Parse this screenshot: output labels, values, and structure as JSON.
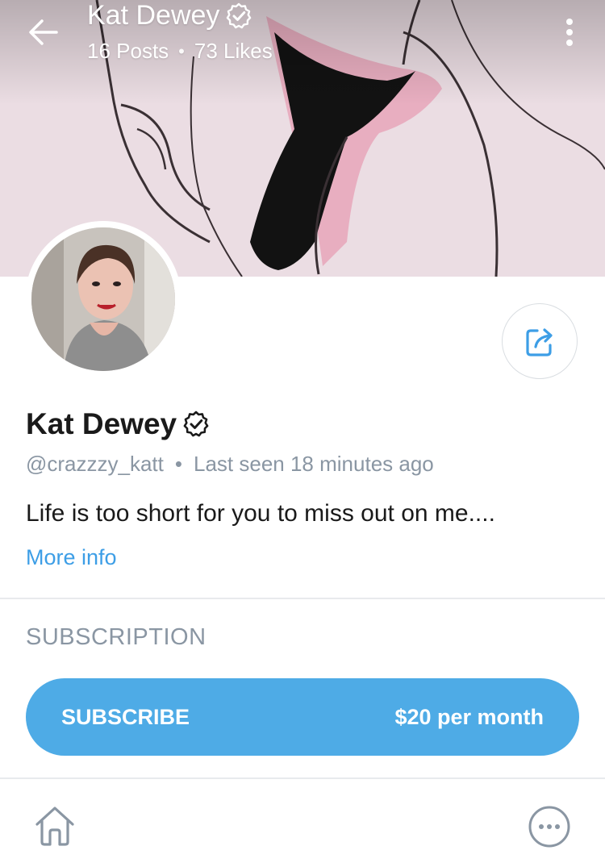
{
  "header": {
    "name": "Kat Dewey",
    "posts": "16 Posts",
    "separator": "•",
    "likes": "73 Likes",
    "back_icon": "arrow-left-icon",
    "menu_icon": "more-vertical-icon"
  },
  "profile": {
    "name": "Kat Dewey",
    "verified_icon": "verified-badge-icon",
    "handle": "@crazzzy_katt",
    "separator": "•",
    "last_seen": "Last seen 18 minutes ago",
    "bio": "Life is too short for you to miss out on me....",
    "more_info": "More info",
    "share_icon": "share-icon"
  },
  "subscription": {
    "title": "SUBSCRIPTION",
    "button_label": "SUBSCRIBE",
    "price": "$20 per month"
  },
  "bottom_nav": {
    "home_icon": "home-icon",
    "more_icon": "more-horizontal-icon"
  },
  "colors": {
    "accent": "#4eabe6",
    "link": "#3d9ee6",
    "muted": "#8a96a3"
  }
}
